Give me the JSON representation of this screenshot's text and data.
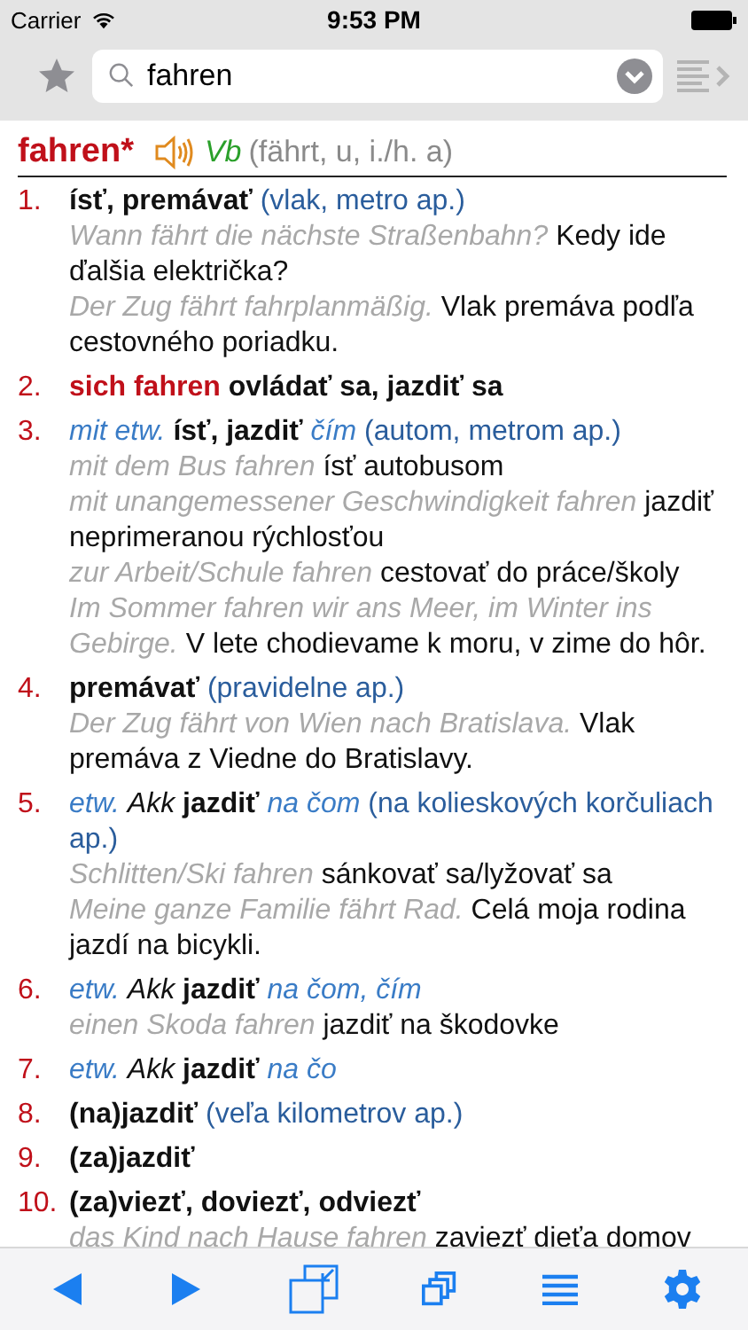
{
  "status_bar": {
    "carrier": "Carrier",
    "time": "9:53 PM"
  },
  "search": {
    "value": "fahren"
  },
  "entry": {
    "headword": "fahren*",
    "part_of_speech": "Vb",
    "forms": "(fährt, u, i./h. a)",
    "senses": [
      {
        "number": "1.",
        "heading": [
          {
            "kind": "translation",
            "text": "ísť, premávať"
          },
          {
            "kind": "note",
            "text": "(vlak, metro ap.)"
          }
        ],
        "examples": [
          {
            "de": "Wann fährt die nächste Straßenbahn?",
            "sk": "Kedy ide ďalšia električka?"
          },
          {
            "de": "Der Zug fährt fahrplanmäßig.",
            "sk": "Vlak premáva podľa cestovného poriadku."
          }
        ]
      },
      {
        "number": "2.",
        "heading": [
          {
            "kind": "phrase",
            "text": "sich fahren"
          },
          {
            "kind": "translation",
            "text": "ovládať sa, jazdiť sa"
          }
        ]
      },
      {
        "number": "3.",
        "heading": [
          {
            "kind": "grammar",
            "text": "mit etw."
          },
          {
            "kind": "translation",
            "text": "ísť, jazdiť"
          },
          {
            "kind": "grammar",
            "text": "čím"
          },
          {
            "kind": "note",
            "text": "(autom, metrom ap.)"
          }
        ],
        "examples": [
          {
            "de": "mit dem Bus fahren",
            "sk": "ísť autobusom"
          },
          {
            "de": "mit unangemessener Geschwindigkeit fahren",
            "sk": "jazdiť neprimeranou rýchlosťou"
          },
          {
            "de": "zur Arbeit/Schule fahren",
            "sk": "cestovať do práce/školy"
          },
          {
            "de": "Im Sommer fahren wir ans Meer, im Winter ins Gebirge.",
            "sk": "V lete chodievame k moru, v zime do hôr."
          }
        ]
      },
      {
        "number": "4.",
        "heading": [
          {
            "kind": "translation",
            "text": "premávať"
          },
          {
            "kind": "note",
            "text": "(pravidelne ap.)"
          }
        ],
        "examples": [
          {
            "de": "Der Zug fährt von Wien nach Bratislava.",
            "sk": "Vlak premáva z Viedne do Bratislavy."
          }
        ]
      },
      {
        "number": "5.",
        "heading": [
          {
            "kind": "grammar",
            "text": "etw."
          },
          {
            "kind": "case",
            "text": "Akk"
          },
          {
            "kind": "translation",
            "text": "jazdiť"
          },
          {
            "kind": "grammar",
            "text": "na čom"
          },
          {
            "kind": "note",
            "text": "(na kolieskových korčuliach ap.)"
          }
        ],
        "examples": [
          {
            "de": "Schlitten/Ski fahren",
            "sk": "sánkovať sa/lyžovať sa"
          },
          {
            "de": "Meine ganze Familie fährt Rad.",
            "sk": "Celá moja rodina jazdí na bicykli."
          }
        ]
      },
      {
        "number": "6.",
        "heading": [
          {
            "kind": "grammar",
            "text": "etw."
          },
          {
            "kind": "case",
            "text": "Akk"
          },
          {
            "kind": "translation",
            "text": "jazdiť"
          },
          {
            "kind": "grammar",
            "text": "na čom, čím"
          }
        ],
        "examples": [
          {
            "de": "einen Skoda fahren",
            "sk": "jazdiť na škodovke"
          }
        ]
      },
      {
        "number": "7.",
        "heading": [
          {
            "kind": "grammar",
            "text": "etw."
          },
          {
            "kind": "case",
            "text": "Akk"
          },
          {
            "kind": "translation",
            "text": "jazdiť"
          },
          {
            "kind": "grammar",
            "text": "na čo"
          }
        ]
      },
      {
        "number": "8.",
        "heading": [
          {
            "kind": "translation",
            "text": "(na)jazdiť"
          },
          {
            "kind": "note",
            "text": "(veľa kilometrov ap.)"
          }
        ]
      },
      {
        "number": "9.",
        "heading": [
          {
            "kind": "translation",
            "text": "(za)jazdiť"
          }
        ]
      },
      {
        "number": "10.",
        "heading": [
          {
            "kind": "translation",
            "text": "(za)viezť, doviezť, odviezť"
          }
        ],
        "examples": [
          {
            "de": "das Kind nach Hause fahren",
            "sk": "zaviezť dieťa domov"
          }
        ]
      }
    ]
  }
}
